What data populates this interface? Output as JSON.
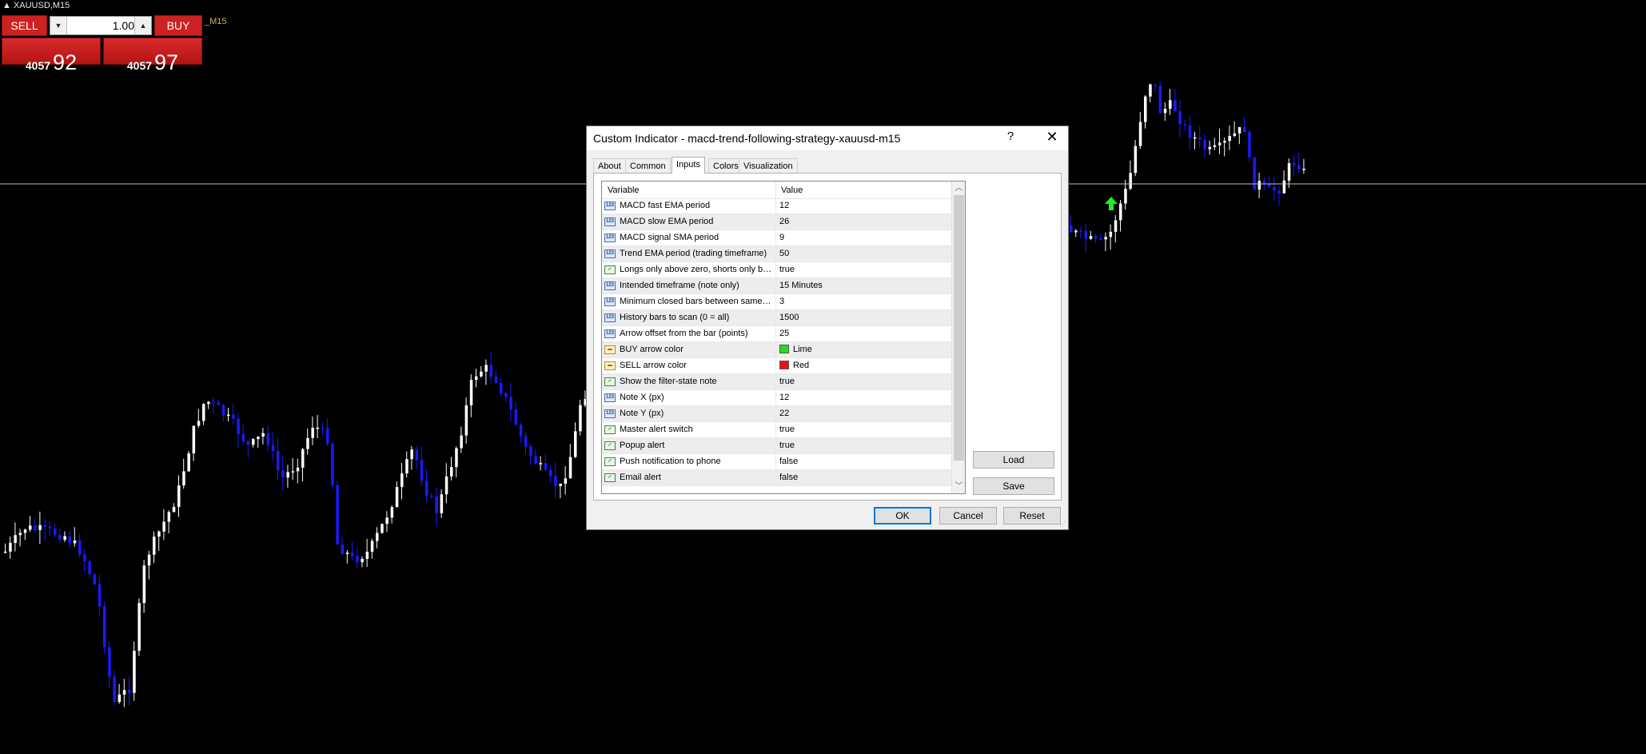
{
  "chart": {
    "symbol": "▲ XAUUSD,M15",
    "indicator_tag": "_M15",
    "horizontal_line_price": "",
    "arrow_color": "#22ee22",
    "bull_color": "#ffffff",
    "bear_color": "#1a1aff"
  },
  "trade_panel": {
    "sell_label": "SELL",
    "buy_label": "BUY",
    "lot_value": "1.00",
    "sell_price_small": "4057",
    "sell_price_big": "92",
    "buy_price_small": "4057",
    "buy_price_big": "97",
    "accent_color": "#cc2222"
  },
  "dialog": {
    "title": "Custom Indicator - macd-trend-following-strategy-xauusd-m15",
    "help_label": "?",
    "close_label": "✕",
    "tabs": [
      {
        "label": "About"
      },
      {
        "label": "Common"
      },
      {
        "label": "Inputs",
        "active": true
      },
      {
        "label": "Colors"
      },
      {
        "label": "Visualization"
      }
    ],
    "grid": {
      "col_variable": "Variable",
      "col_value": "Value",
      "rows": [
        {
          "type": "int",
          "icon": "123",
          "variable": "MACD fast EMA period",
          "value": "12"
        },
        {
          "type": "int",
          "icon": "123",
          "variable": "MACD slow EMA period",
          "value": "26"
        },
        {
          "type": "int",
          "icon": "123",
          "variable": "MACD signal SMA period",
          "value": "9"
        },
        {
          "type": "int",
          "icon": "123",
          "variable": "Trend EMA period (trading timeframe)",
          "value": "50"
        },
        {
          "type": "bool",
          "icon": "✓",
          "variable": "Longs only above zero, shorts only be...",
          "value": "true"
        },
        {
          "type": "int",
          "icon": "123",
          "variable": "Intended timeframe (note only)",
          "value": "15 Minutes"
        },
        {
          "type": "int",
          "icon": "123",
          "variable": "Minimum closed bars between same-si...",
          "value": "3"
        },
        {
          "type": "int",
          "icon": "123",
          "variable": "History bars to scan (0 = all)",
          "value": "1500"
        },
        {
          "type": "int",
          "icon": "123",
          "variable": "Arrow offset from the bar (points)",
          "value": "25"
        },
        {
          "type": "color",
          "icon": "▬",
          "variable": "BUY arrow color",
          "value": "Lime",
          "swatch": "#22dd22"
        },
        {
          "type": "color",
          "icon": "▬",
          "variable": "SELL arrow color",
          "value": "Red",
          "swatch": "#ee1111"
        },
        {
          "type": "bool",
          "icon": "✓",
          "variable": "Show the filter-state note",
          "value": "true"
        },
        {
          "type": "int",
          "icon": "123",
          "variable": "Note X (px)",
          "value": "12"
        },
        {
          "type": "int",
          "icon": "123",
          "variable": "Note Y (px)",
          "value": "22"
        },
        {
          "type": "bool",
          "icon": "✓",
          "variable": "Master alert switch",
          "value": "true"
        },
        {
          "type": "bool",
          "icon": "✓",
          "variable": "Popup alert",
          "value": "true"
        },
        {
          "type": "bool",
          "icon": "✓",
          "variable": "Push notification to phone",
          "value": "false"
        },
        {
          "type": "bool",
          "icon": "✓",
          "variable": "Email alert",
          "value": "false"
        }
      ]
    },
    "buttons": {
      "load": "Load",
      "save": "Save",
      "ok": "OK",
      "cancel": "Cancel",
      "reset": "Reset"
    }
  }
}
